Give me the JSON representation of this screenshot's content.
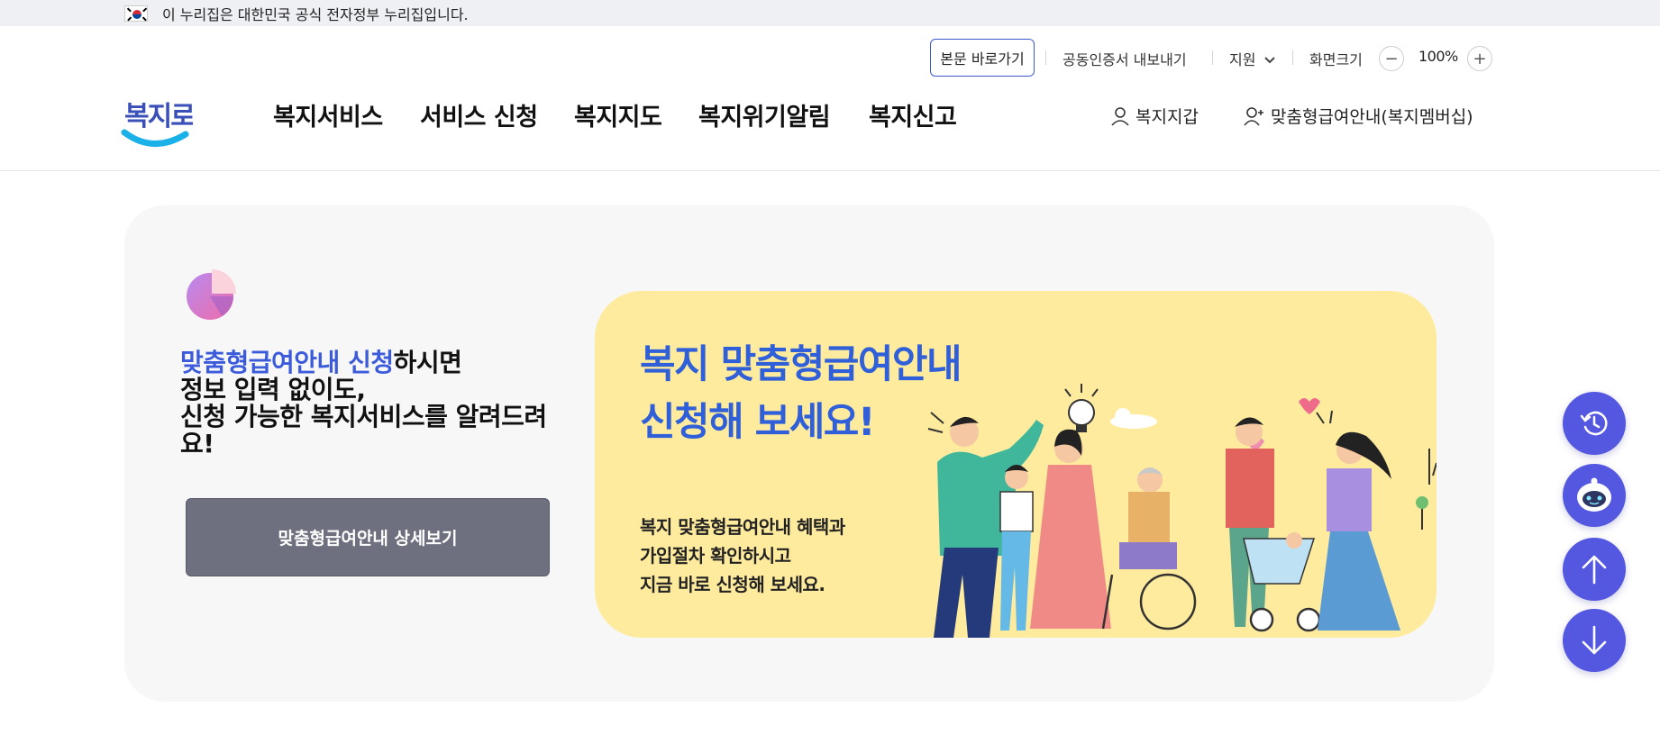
{
  "gov_banner": {
    "text": "이 누리집은 대한민국 공식 전자정부 누리집입니다."
  },
  "utility": {
    "skip_to_content": "본문 바로가기",
    "cert_export": "공동인증서 내보내기",
    "support": "지원",
    "screen_size": "화면크기",
    "zoom_minus": "−",
    "zoom_value": "100%",
    "zoom_plus": "+"
  },
  "logo": {
    "text": "복지로"
  },
  "gnb": [
    {
      "label": "복지서비스"
    },
    {
      "label": "서비스 신청"
    },
    {
      "label": "복지지도"
    },
    {
      "label": "복지위기알림"
    },
    {
      "label": "복지신고"
    }
  ],
  "quick_links": {
    "wallet": "복지지갑",
    "membership": "맞춤형급여안내(복지멤버십)"
  },
  "promo": {
    "title_highlight": "맞춤형급여안내 신청",
    "title_rest_1": "하시면",
    "title_line_2": "정보 입력 없이도,",
    "title_line_3": "신청 가능한 복지서비스를 알려드려요!",
    "detail_button": "맞춤형급여안내 상세보기"
  },
  "banner": {
    "title_line_1": "복지 맞춤형급여안내",
    "title_line_2": "신청해 보세요!",
    "desc_line_1": "복지 맞춤형급여안내 혜택과",
    "desc_line_2": "가입절차 확인하시고",
    "desc_line_3": "지금 바로 신청해 보세요."
  },
  "colors": {
    "accent_blue": "#3b5bdb",
    "banner_bg": "#ffeb9e",
    "fab_bg": "#5457e0",
    "detail_button_bg": "#6e7080"
  },
  "floating_buttons": [
    {
      "icon": "history-icon"
    },
    {
      "icon": "chatbot-icon"
    },
    {
      "icon": "arrow-up-icon"
    },
    {
      "icon": "arrow-down-icon"
    }
  ]
}
